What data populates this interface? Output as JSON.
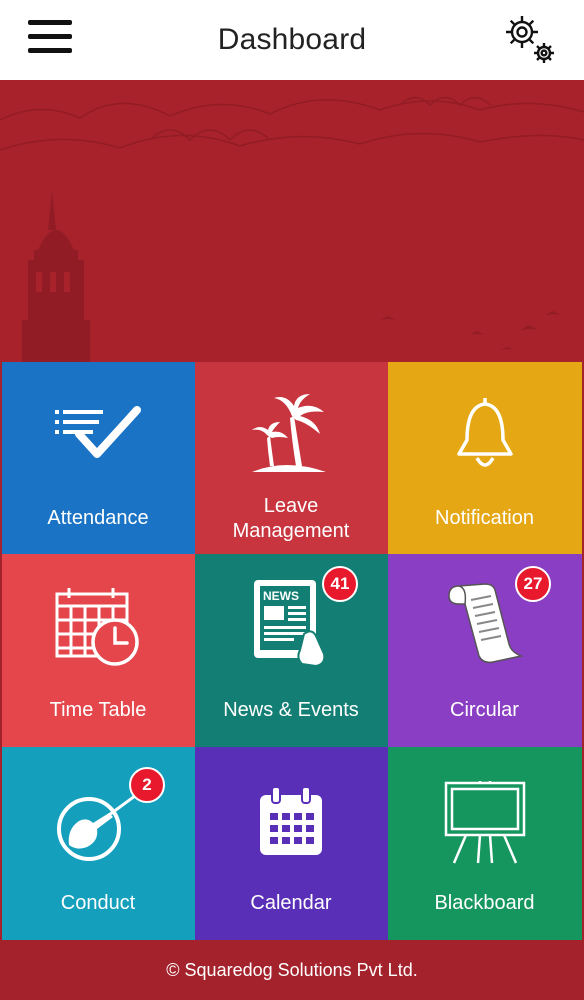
{
  "header": {
    "title": "Dashboard",
    "menu_icon": "hamburger-menu-icon",
    "settings_icon": "gears-icon"
  },
  "colors": {
    "header_bg": "#ffffff",
    "banner_bg": "#a7222b",
    "footer_bg": "#a4222c",
    "badge_bg": "#e8192c"
  },
  "tiles": [
    {
      "label": "Attendance",
      "icon": "checklist-icon",
      "color": "#1a73c4",
      "badge": ""
    },
    {
      "label_line1": "Leave",
      "label_line2": "Management",
      "icon": "palm-island-icon",
      "color": "#c8353f",
      "badge": ""
    },
    {
      "label": "Notification",
      "icon": "bell-icon",
      "color": "#e5a714",
      "badge": ""
    },
    {
      "label": "Time Table",
      "icon": "timetable-clock-icon",
      "color": "#e4464b",
      "badge": ""
    },
    {
      "label": "News & Events",
      "icon": "newspaper-icon",
      "color": "#137e73",
      "badge": "41"
    },
    {
      "label": "Circular",
      "icon": "scroll-icon",
      "color": "#8a3ec3",
      "badge": "27"
    },
    {
      "label": "Conduct",
      "icon": "conductor-baton-icon",
      "color": "#149fbd",
      "badge": "2"
    },
    {
      "label": "Calendar",
      "icon": "calendar-icon",
      "color": "#5a2fb8",
      "badge": ""
    },
    {
      "label": "Blackboard",
      "icon": "blackboard-easel-icon",
      "color": "#16965f",
      "badge": ""
    }
  ],
  "footer": {
    "text": "© Squaredog Solutions Pvt Ltd."
  }
}
